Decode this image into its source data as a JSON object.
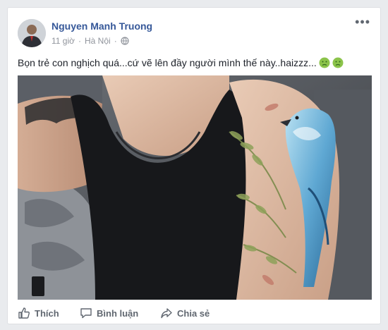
{
  "post": {
    "author": "Nguyen Manh Truong",
    "time": "11 giờ",
    "separator": "·",
    "location": "Hà Nội",
    "privacy_icon": "globe-icon",
    "more_label": "•••",
    "caption": "Bọn trẻ con nghịch quá...cứ vẽ lên đầy người mình thế này..haizzz...",
    "caption_emoji": [
      "sick-face-icon",
      "sick-face-icon"
    ]
  },
  "actions": {
    "like": "Thích",
    "comment": "Bình luận",
    "share": "Chia sẻ"
  },
  "colors": {
    "author": "#365899",
    "meta": "#90949c",
    "action": "#606770",
    "emoji": "#7cb342"
  }
}
